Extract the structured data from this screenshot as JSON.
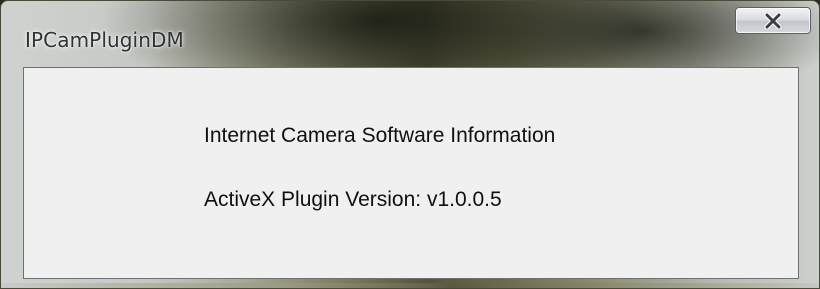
{
  "window": {
    "title": "IPCamPluginDM",
    "close_icon": "close-x-icon"
  },
  "content": {
    "heading": "Internet Camera Software Information",
    "version_line": "ActiveX Plugin Version: v1.0.0.5"
  },
  "colors": {
    "client_background": "#f0f0f0",
    "text": "#101010"
  }
}
